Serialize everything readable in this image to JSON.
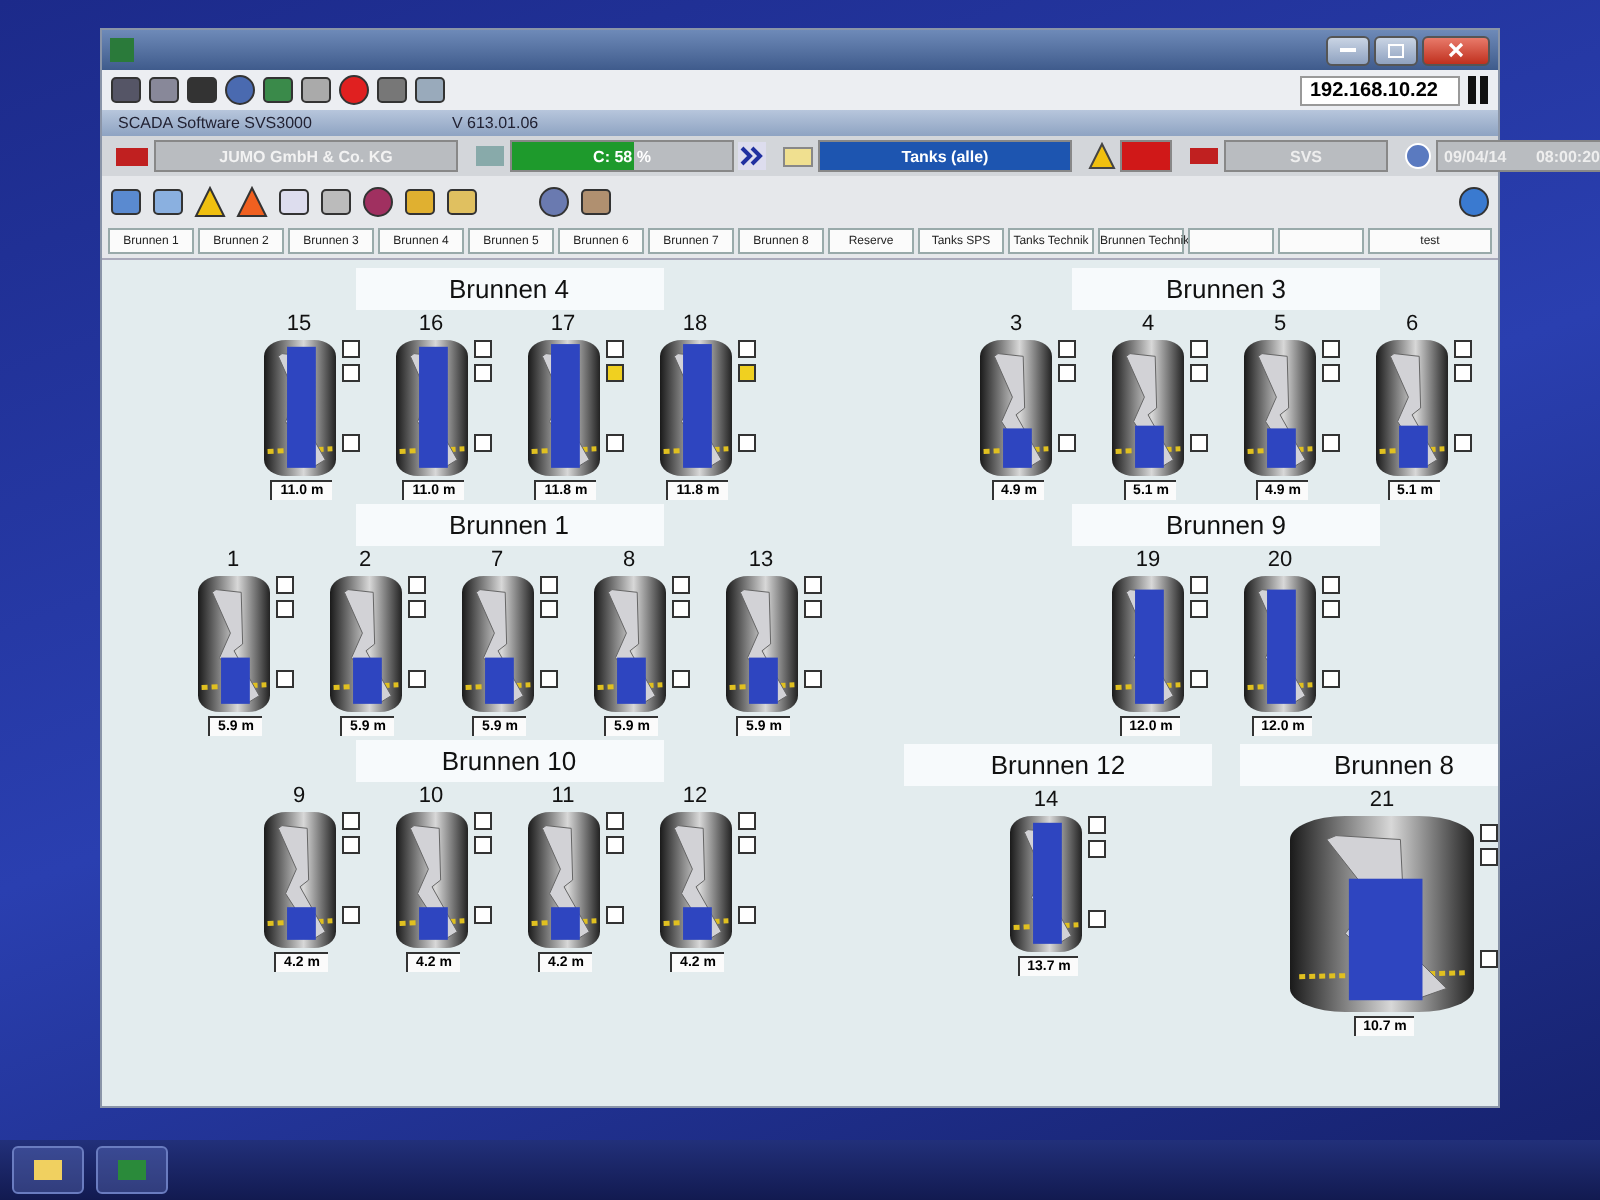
{
  "window": {
    "ip": "192.168.10.22"
  },
  "info_bar": {
    "product": "SCADA Software  SVS3000",
    "version": "V 613.01.06"
  },
  "status_row": {
    "company": "JUMO GmbH & Co. KG",
    "cpu": {
      "text": "C:  58 %",
      "level": 0.55
    },
    "view": "Tanks (alle)",
    "alarm": true,
    "station": "SVS",
    "date": "09/04/14",
    "time": "08:00:20"
  },
  "tabs": [
    {
      "label": "Brunnen 1",
      "selected": false
    },
    {
      "label": "Brunnen 2",
      "selected": false
    },
    {
      "label": "Brunnen 3",
      "selected": false
    },
    {
      "label": "Brunnen 4",
      "selected": false
    },
    {
      "label": "Brunnen 5",
      "selected": false
    },
    {
      "label": "Brunnen 6",
      "selected": false
    },
    {
      "label": "Brunnen 7",
      "selected": false
    },
    {
      "label": "Brunnen 8",
      "selected": false
    },
    {
      "label": "Reserve",
      "selected": false
    },
    {
      "label": "Tanks SPS",
      "selected": false
    },
    {
      "label": "Tanks Technik",
      "selected": false
    },
    {
      "label": "Brunnen Technik",
      "selected": false
    },
    {
      "selected": false
    },
    {
      "selected": false
    },
    {
      "label": "test",
      "selected": false
    }
  ],
  "canvas": {
    "left": [
      {
        "title": "Brunnen 4",
        "tanks": [
          {
            "label": "15",
            "level": 0.95,
            "reading": "11.0 m",
            "large": false,
            "indicators": [
              {
                "on": false
              },
              {
                "on": false
              },
              {
                "on": false
              }
            ]
          },
          {
            "label": "16",
            "level": 0.95,
            "reading": "11.0 m",
            "large": false,
            "indicators": [
              {
                "on": false
              },
              {
                "on": false
              },
              {
                "on": false
              }
            ]
          },
          {
            "label": "17",
            "level": 0.97,
            "reading": "11.8 m",
            "large": false,
            "indicators": [
              {
                "on": false
              },
              {
                "on": true
              },
              {
                "on": false
              }
            ]
          },
          {
            "label": "18",
            "level": 0.97,
            "reading": "11.8 m",
            "large": false,
            "indicators": [
              {
                "on": false
              },
              {
                "on": true
              },
              {
                "on": false
              }
            ]
          }
        ]
      },
      {
        "title": "Brunnen 1",
        "tanks": [
          {
            "label": "1",
            "level": 0.4,
            "reading": "5.9 m",
            "large": false,
            "indicators": [
              {
                "on": false
              },
              {
                "on": false
              },
              {
                "on": false
              }
            ]
          },
          {
            "label": "2",
            "level": 0.4,
            "reading": "5.9 m",
            "large": false,
            "indicators": [
              {
                "on": false
              },
              {
                "on": false
              },
              {
                "on": false
              }
            ]
          },
          {
            "label": "7",
            "level": 0.4,
            "reading": "5.9 m",
            "large": false,
            "indicators": [
              {
                "on": false
              },
              {
                "on": false
              },
              {
                "on": false
              }
            ]
          },
          {
            "label": "8",
            "level": 0.4,
            "reading": "5.9 m",
            "large": false,
            "indicators": [
              {
                "on": false
              },
              {
                "on": false
              },
              {
                "on": false
              }
            ]
          },
          {
            "label": "13",
            "level": 0.4,
            "reading": "5.9 m",
            "large": false,
            "indicators": [
              {
                "on": false
              },
              {
                "on": false
              },
              {
                "on": false
              }
            ]
          }
        ]
      },
      {
        "title": "Brunnen 10",
        "tanks": [
          {
            "label": "9",
            "level": 0.3,
            "reading": "4.2 m",
            "large": false,
            "indicators": [
              {
                "on": false
              },
              {
                "on": false
              },
              {
                "on": false
              }
            ]
          },
          {
            "label": "10",
            "level": 0.3,
            "reading": "4.2 m",
            "large": false,
            "indicators": [
              {
                "on": false
              },
              {
                "on": false
              },
              {
                "on": false
              }
            ]
          },
          {
            "label": "11",
            "level": 0.3,
            "reading": "4.2 m",
            "large": false,
            "indicators": [
              {
                "on": false
              },
              {
                "on": false
              },
              {
                "on": false
              }
            ]
          },
          {
            "label": "12",
            "level": 0.3,
            "reading": "4.2 m",
            "large": false,
            "indicators": [
              {
                "on": false
              },
              {
                "on": false
              },
              {
                "on": false
              }
            ]
          }
        ]
      }
    ],
    "right": [
      {
        "title": "Brunnen 3",
        "tanks": [
          {
            "label": "3",
            "level": 0.35,
            "reading": "4.9 m",
            "large": false,
            "indicators": [
              {
                "on": false
              },
              {
                "on": false
              },
              {
                "on": false
              }
            ]
          },
          {
            "label": "4",
            "level": 0.37,
            "reading": "5.1 m",
            "large": false,
            "indicators": [
              {
                "on": false
              },
              {
                "on": false
              },
              {
                "on": false
              }
            ]
          },
          {
            "label": "5",
            "level": 0.35,
            "reading": "4.9 m",
            "large": false,
            "indicators": [
              {
                "on": false
              },
              {
                "on": false
              },
              {
                "on": false
              }
            ]
          },
          {
            "label": "6",
            "level": 0.37,
            "reading": "5.1 m",
            "large": false,
            "indicators": [
              {
                "on": false
              },
              {
                "on": false
              },
              {
                "on": false
              }
            ]
          }
        ]
      },
      {
        "title": "Brunnen 9",
        "tanks": [
          {
            "label": "19",
            "level": 0.9,
            "reading": "12.0 m",
            "large": false,
            "indicators": [
              {
                "on": false
              },
              {
                "on": false
              },
              {
                "on": false
              }
            ]
          },
          {
            "label": "20",
            "level": 0.9,
            "reading": "12.0 m",
            "large": false,
            "indicators": [
              {
                "on": false
              },
              {
                "on": false
              },
              {
                "on": false
              }
            ]
          }
        ]
      }
    ],
    "right_bottom": [
      {
        "title": "Brunnen 12",
        "tanks": [
          {
            "label": "14",
            "level": 0.95,
            "reading": "13.7 m",
            "large": false,
            "indicators": [
              {
                "on": false
              },
              {
                "on": false
              },
              {
                "on": false
              }
            ]
          }
        ]
      },
      {
        "title": "Brunnen 8",
        "tanks": [
          {
            "label": "21",
            "level": 0.68,
            "reading": "10.7 m",
            "large": true,
            "indicators": [
              {
                "on": false
              },
              {
                "on": false
              },
              {
                "on": false
              }
            ]
          }
        ]
      }
    ]
  }
}
